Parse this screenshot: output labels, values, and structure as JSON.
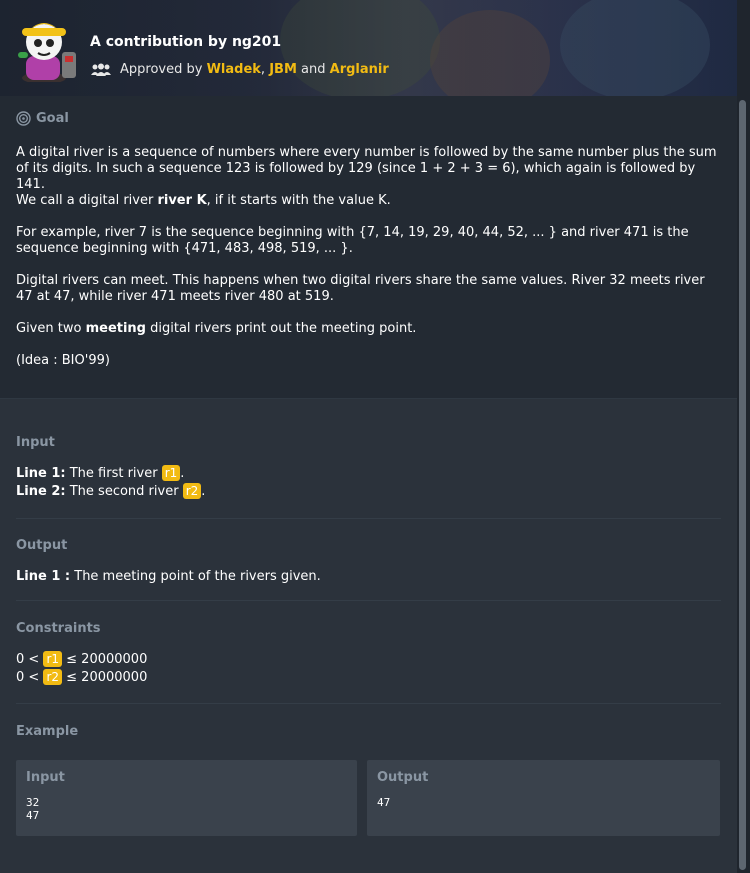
{
  "header": {
    "title": "A contribution by ng201",
    "approved_prefix": "Approved by",
    "approvers": [
      "Wladek",
      "JBM",
      "Arglanir"
    ],
    "sep_comma": ",",
    "sep_and": "and"
  },
  "goal": {
    "title": "Goal",
    "p1": "A digital river is a sequence of numbers where every number is followed by the same number plus the sum of its digits. In such a sequence 123 is followed by 129 (since 1 + 2 + 3 = 6), which again is followed by 141.",
    "p2_pre": "We call a digital river",
    "p2_bold": "river K",
    "p2_post": ", if it starts with the value K.",
    "p3": "For example, river 7 is the sequence beginning with {7, 14, 19, 29, 40, 44, 52, ... } and river 471 is the sequence beginning with {471, 483, 498, 519, ... }.",
    "p4": "Digital rivers can meet. This happens when two digital rivers share the same values. River 32 meets river 47 at 47, while river 471 meets river 480 at 519.",
    "p5_pre": "Given two",
    "p5_bold": "meeting",
    "p5_post": "digital rivers print out the meeting point.",
    "p6": "(Idea : BIO'99)"
  },
  "input": {
    "title": "Input",
    "line1_label": "Line 1:",
    "line1_text": "The first river",
    "line1_var": "r1",
    "line2_label": "Line 2:",
    "line2_text": "The second river",
    "line2_var": "r2",
    "period": "."
  },
  "output": {
    "title": "Output",
    "line1_label": "Line 1 :",
    "line1_text": "The meeting point of the rivers given."
  },
  "constraints": {
    "title": "Constraints",
    "c1_pre": "0 <",
    "c1_var": "r1",
    "c1_post": "≤ 20000000",
    "c2_pre": "0 <",
    "c2_var": "r2",
    "c2_post": "≤ 20000000"
  },
  "example": {
    "title": "Example",
    "input_title": "Input",
    "input_content": "32\n47",
    "output_title": "Output",
    "output_content": "47"
  },
  "colors": {
    "accent": "#f2bb13",
    "section_title": "#8a96a3",
    "background": "#2b323b"
  }
}
